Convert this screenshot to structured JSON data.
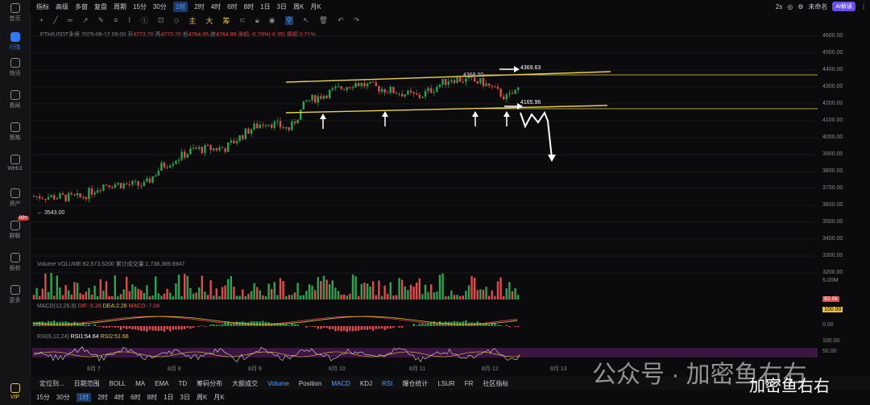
{
  "sidebar": {
    "items": [
      {
        "label": "首页",
        "icon": "home-icon"
      },
      {
        "label": "行情",
        "icon": "market-icon",
        "active": true
      },
      {
        "label": "快讯",
        "icon": "news-icon"
      },
      {
        "label": "看闻",
        "icon": "article-icon"
      },
      {
        "label": "策略",
        "icon": "strategy-icon"
      },
      {
        "label": "Web3",
        "icon": "web3-icon"
      },
      {
        "label": "资产",
        "icon": "wallet-icon"
      },
      {
        "label": "群聊",
        "icon": "chat-icon",
        "badge": "99+"
      },
      {
        "label": "报权",
        "icon": "report-icon"
      },
      {
        "label": "更多",
        "icon": "more-icon"
      },
      {
        "label": "VIP",
        "icon": "vip-icon"
      }
    ]
  },
  "toolbar1": {
    "items": [
      "指标",
      "高级",
      "多窗",
      "复盘",
      "周期",
      "15分",
      "30分",
      "1时",
      "2时",
      "4时",
      "6时",
      "8时",
      "1日",
      "3日",
      "周K",
      "月K"
    ],
    "selected": "1时",
    "right": {
      "latency": "2s",
      "user": "未命名",
      "ai": "AI解读"
    }
  },
  "toolbar2": {
    "items": [
      "主",
      "大",
      "筹"
    ]
  },
  "info": {
    "symbol": "ETH/USDT永续",
    "datetime": "2025-08-12 09:00",
    "open_label": "开",
    "open": "4273.20",
    "high_label": "高",
    "high": "4273.20",
    "low_label": "低",
    "low": "4264.05",
    "close_label": "收",
    "close": "4264.89",
    "change": "涨幅 -0.20%(-8.35)",
    "amplitude": "振幅 0.21%"
  },
  "price_axis": [
    "4600.00",
    "4500.00",
    "4400.00",
    "4300.00",
    "4200.00",
    "4100.00",
    "4000.00",
    "3900.00",
    "3800.00",
    "3700.00",
    "3600.00",
    "3500.00",
    "3400.00",
    "3300.00",
    "3200.00"
  ],
  "annotations": {
    "top_price": "4369.63",
    "mid_price": "4165.96",
    "peak": "4368.00",
    "low_mark": "3543.00"
  },
  "volume": {
    "title": "Volume VOLUME:82,573.5200",
    "sub": "累计成交量:1,738,389.8947",
    "axis": [
      "5.00M",
      "82.6k"
    ]
  },
  "macd": {
    "title": "MACD(12,26,9)",
    "dif": "DIF:-5.26",
    "dea": "DEA:2.26",
    "macd": "MACD:-7.04",
    "axis": [
      "100.00",
      "0.00"
    ]
  },
  "rsi": {
    "title": "RSI(6,12,24)",
    "rsi1": "RSI1:54.64",
    "rsi2": "RSI2:51.66",
    "axis": [
      "100.00",
      "50.00",
      "0.00"
    ]
  },
  "xaxis": [
    "8月 7",
    "8月 8",
    "8月 9",
    "8月 10",
    "8月 11",
    "8月 12",
    "8月 13"
  ],
  "bottom1": {
    "items": [
      "定位到...",
      "日期范围",
      "BOLL",
      "MA",
      "EMA",
      "TD",
      "筹码分布",
      "大额成交",
      "Volume",
      "Position",
      "MACD",
      "KDJ",
      "RSI",
      "爆仓统计",
      "LSUR",
      "FR",
      "社区指标"
    ],
    "selected": [
      "Volume",
      "MACD",
      "RSI"
    ]
  },
  "bottom2": {
    "items": [
      "15分",
      "30分",
      "1时",
      "2时",
      "4时",
      "6时",
      "8时",
      "1日",
      "3日",
      "周K",
      "月K"
    ],
    "selected": "1时"
  },
  "watermark": {
    "text": "公众号 · 加密鱼右右",
    "text2": "加密鱼右右"
  },
  "colors": {
    "up": "#25a750",
    "down": "#e04b4b",
    "trend": "#e8d44d",
    "accent": "#2f7bf5"
  }
}
